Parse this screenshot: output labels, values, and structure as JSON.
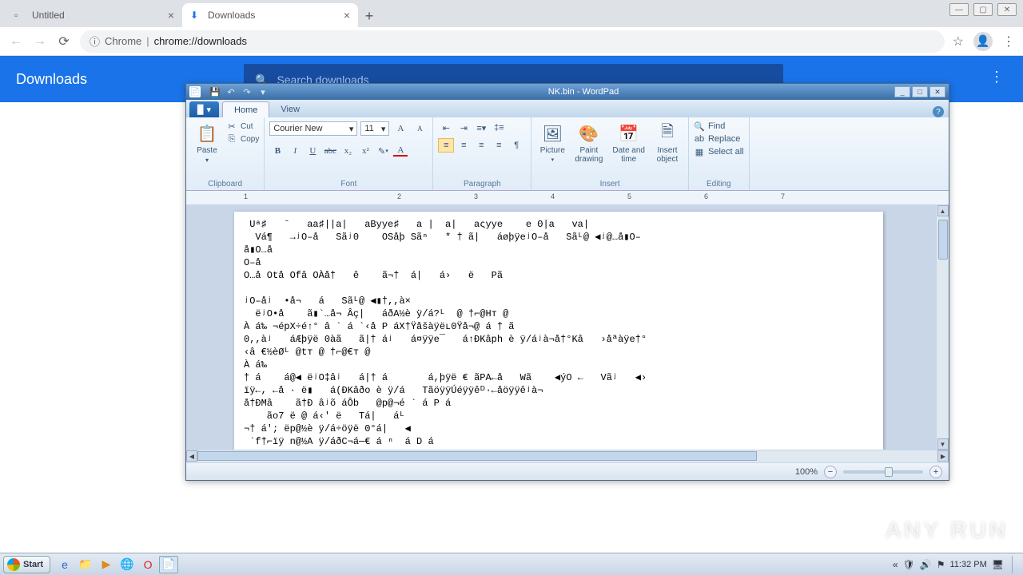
{
  "chrome": {
    "tabs": [
      {
        "title": "Untitled",
        "active": false
      },
      {
        "title": "Downloads",
        "active": true
      }
    ],
    "address": {
      "protocol_label": "Chrome",
      "host_sep": " | ",
      "url": "chrome://downloads"
    },
    "downloads_page": {
      "title": "Downloads",
      "search_placeholder": "Search downloads"
    }
  },
  "wordpad": {
    "title": "NK.bin - WordPad",
    "tabs": {
      "home": "Home",
      "view": "View"
    },
    "ribbon": {
      "clipboard": {
        "paste": "Paste",
        "cut": "Cut",
        "copy": "Copy",
        "label": "Clipboard"
      },
      "font": {
        "name": "Courier New",
        "size": "11",
        "label": "Font",
        "bold": "B",
        "italic": "I",
        "underline": "U",
        "strike": "abc",
        "sub": "x₂",
        "sup": "x²"
      },
      "paragraph": {
        "label": "Paragraph"
      },
      "insert": {
        "picture": "Picture",
        "paint": "Paint\ndrawing",
        "datetime": "Date and\ntime",
        "object": "Insert\nobject",
        "label": "Insert"
      },
      "editing": {
        "find": "Find",
        "replace": "Replace",
        "selectall": "Select all",
        "label": "Editing"
      }
    },
    "ruler_marks": [
      "1",
      "2",
      "3",
      "4",
      "5",
      "6",
      "7"
    ],
    "zoom": "100%",
    "document_lines": [
      " Uᵃ♯   ˉ   aa♯||a|   aByye♯   a |  a|   aςyye    e ʘ|a   va|",
      "  Vá¶   →ʲO–å   Sãʲ0    OSåþ Sãⁿ   * † ã|   áøþÿeʲO–å   Sãᴸ@ ◀ʲ@…å▮O–",
      "å▮O…å",
      "O–å",
      "O…å Otå Ofâ OÀå†   ê    ã¬†  á|   á›   ë   Pã",
      "",
      "ʲO–åʲ  •å¬   á   Sãᴸ@ ◀▮†,,à×",
      "  ëʲO•å    ã▮`…å¬ Âç|   áðA½è ÿ/á?ᴸ  @ †⌐@Hт @",
      "À á‰ ¬épX÷é↑° â ` á `‹å P áX†Ÿåšàÿëʟ0Ÿå¬@ á † ã",
      "0,,àʲ   áÆþÿë 0àã   ã|† áʲ   á¤ÿÿe¯   á↑ÐKâph è ÿ/áʲà¬å†°Kâ   ›åªàÿe†°",
      "‹â €½èØᴸ @tт @ †⌐@€т @",
      "À á‰",
      "† á    á@◀ ëʲO‡âʲ   á|† á       á,þÿë € ãPA←å   Wã    ◀ýO ←   Vãʲ   ◀›",
      "ïÿ←, ←å · ë▮   á(ÐKâðo è ÿ/á   TãöÿÿÚéÿÿêᴰ·←åöÿÿêʲà¬",
      "å†ÐMâ    ã†Ð âʲõ áÔb   @p@¬é ` á P á",
      "    ão7 ë @ á‹' ë   Tá|   áᴸ",
      "¬† á'; ëp@½è ÿ/á÷öÿë 0°á|   ◀",
      " `f†⌐ïÿ n@½A ÿ/áðC¬á─€ á ⁿ  á D á"
    ]
  },
  "taskbar": {
    "start": "Start",
    "time": "11:32 PM"
  },
  "watermark": "ANY     RUN"
}
